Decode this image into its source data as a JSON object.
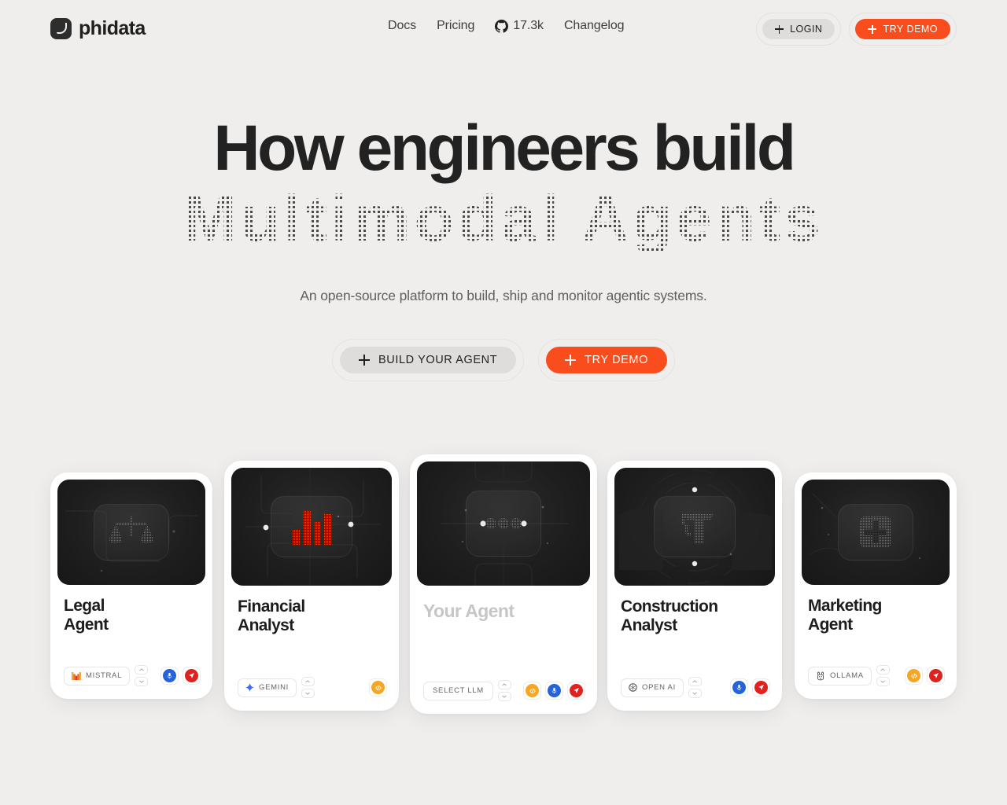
{
  "header": {
    "brand": "phidata",
    "nav": [
      {
        "label": "Docs",
        "icon": null
      },
      {
        "label": "Pricing",
        "icon": null
      },
      {
        "label": "17.3k",
        "icon": "github-icon"
      },
      {
        "label": "Changelog",
        "icon": null
      }
    ],
    "login_label": "LOGIN",
    "demo_label": "TRY DEMO"
  },
  "hero": {
    "line1": "How engineers build",
    "line2": "Multimodal Agents",
    "subtitle": "An open-source platform to build, ship and monitor agentic systems.",
    "cta_build": "BUILD YOUR AGENT",
    "cta_demo": "TRY DEMO"
  },
  "colors": {
    "accent": "#f94d1d",
    "glyph": "#f0441c",
    "page_bg": "#efeeed",
    "card_bg": "#ffffff",
    "thumb_bg": "#1e1e1e",
    "muted_text": "#c6c6c6"
  },
  "cards": [
    {
      "title": "Legal\nAgent",
      "glyph": "scales-icon",
      "llm": "MISTRAL",
      "llm_logo": "mistral-icon",
      "muted": false,
      "actions": [
        "mic-icon",
        "send-icon"
      ]
    },
    {
      "title": "Financial\nAnalyst",
      "glyph": "bar-chart-icon",
      "llm": "GEMINI",
      "llm_logo": "gemini-icon",
      "muted": false,
      "actions": [
        "code-icon"
      ]
    },
    {
      "title": "Your Agent",
      "glyph": "three-dots-icon",
      "llm": "SELECT LLM",
      "llm_logo": null,
      "muted": true,
      "actions": [
        "code-icon",
        "mic-icon",
        "send-icon"
      ]
    },
    {
      "title": "Construction\nAnalyst",
      "glyph": "crane-icon",
      "llm": "OPEN AI",
      "llm_logo": "openai-icon",
      "muted": false,
      "actions": [
        "mic-icon",
        "send-icon"
      ]
    },
    {
      "title": "Marketing\nAgent",
      "glyph": "plus-square-icon",
      "llm": "OLLAMA",
      "llm_logo": "ollama-icon",
      "muted": false,
      "actions": [
        "code-icon",
        "send-icon"
      ]
    }
  ]
}
